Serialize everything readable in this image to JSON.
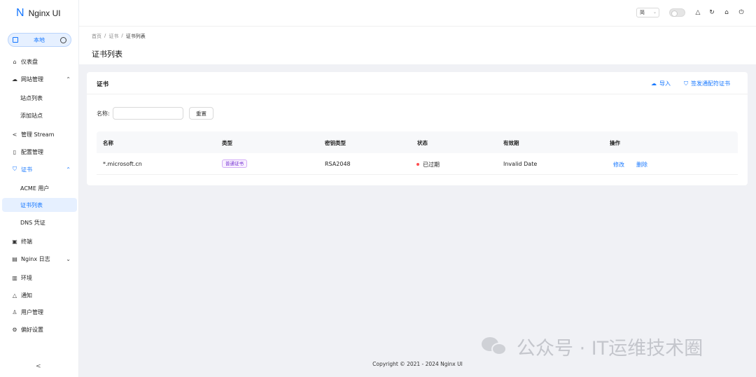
{
  "app": {
    "logo_mark": "N",
    "title": "Nginx UI"
  },
  "env": {
    "label": "本地"
  },
  "sidebar": {
    "items": [
      {
        "label": "仪表盘",
        "icon": "home-icon"
      },
      {
        "label": "网站管理",
        "icon": "cloud-icon",
        "expanded": true
      },
      {
        "label": "站点列表"
      },
      {
        "label": "添加站点"
      },
      {
        "label": "管理 Stream",
        "icon": "share-icon"
      },
      {
        "label": "配置管理",
        "icon": "file-icon"
      },
      {
        "label": "证书",
        "icon": "shield-icon",
        "expanded": true
      },
      {
        "label": "ACME 用户"
      },
      {
        "label": "证书列表",
        "selected": true
      },
      {
        "label": "DNS 凭证"
      },
      {
        "label": "终端",
        "icon": "terminal-icon"
      },
      {
        "label": "Nginx 日志",
        "icon": "file-text-icon"
      },
      {
        "label": "环境",
        "icon": "database-icon"
      },
      {
        "label": "通知",
        "icon": "bell-icon"
      },
      {
        "label": "用户管理",
        "icon": "user-icon"
      },
      {
        "label": "偏好设置",
        "icon": "settings-icon"
      }
    ],
    "collapse_glyph": "<"
  },
  "header": {
    "language": "简"
  },
  "breadcrumb": {
    "items": [
      "首页",
      "证书",
      "证书列表"
    ],
    "separator": "/"
  },
  "page": {
    "title": "证书列表"
  },
  "card": {
    "title": "证书",
    "import_label": "导入",
    "issue_wildcard_label": "签发通配符证书",
    "search_label": "名称:",
    "search_value": "",
    "reset_label": "重置"
  },
  "table": {
    "columns": [
      "名称",
      "类型",
      "密钥类型",
      "状态",
      "有效期",
      "操作"
    ],
    "rows": [
      {
        "name": "*.microsoft.cn",
        "type": "普通证书",
        "key_type": "RSA2048",
        "status": "已过期",
        "validity": "Invalid Date",
        "edit": "修改",
        "delete": "删除"
      }
    ]
  },
  "footer": {
    "copyright": "Copyright © 2021 - 2024 Nginx UI"
  },
  "watermark": {
    "text": "公众号 · IT运维技术圈"
  },
  "colors": {
    "primary": "#1677ff",
    "danger": "#ff4d4f",
    "tag_purple": "#722ed1"
  }
}
